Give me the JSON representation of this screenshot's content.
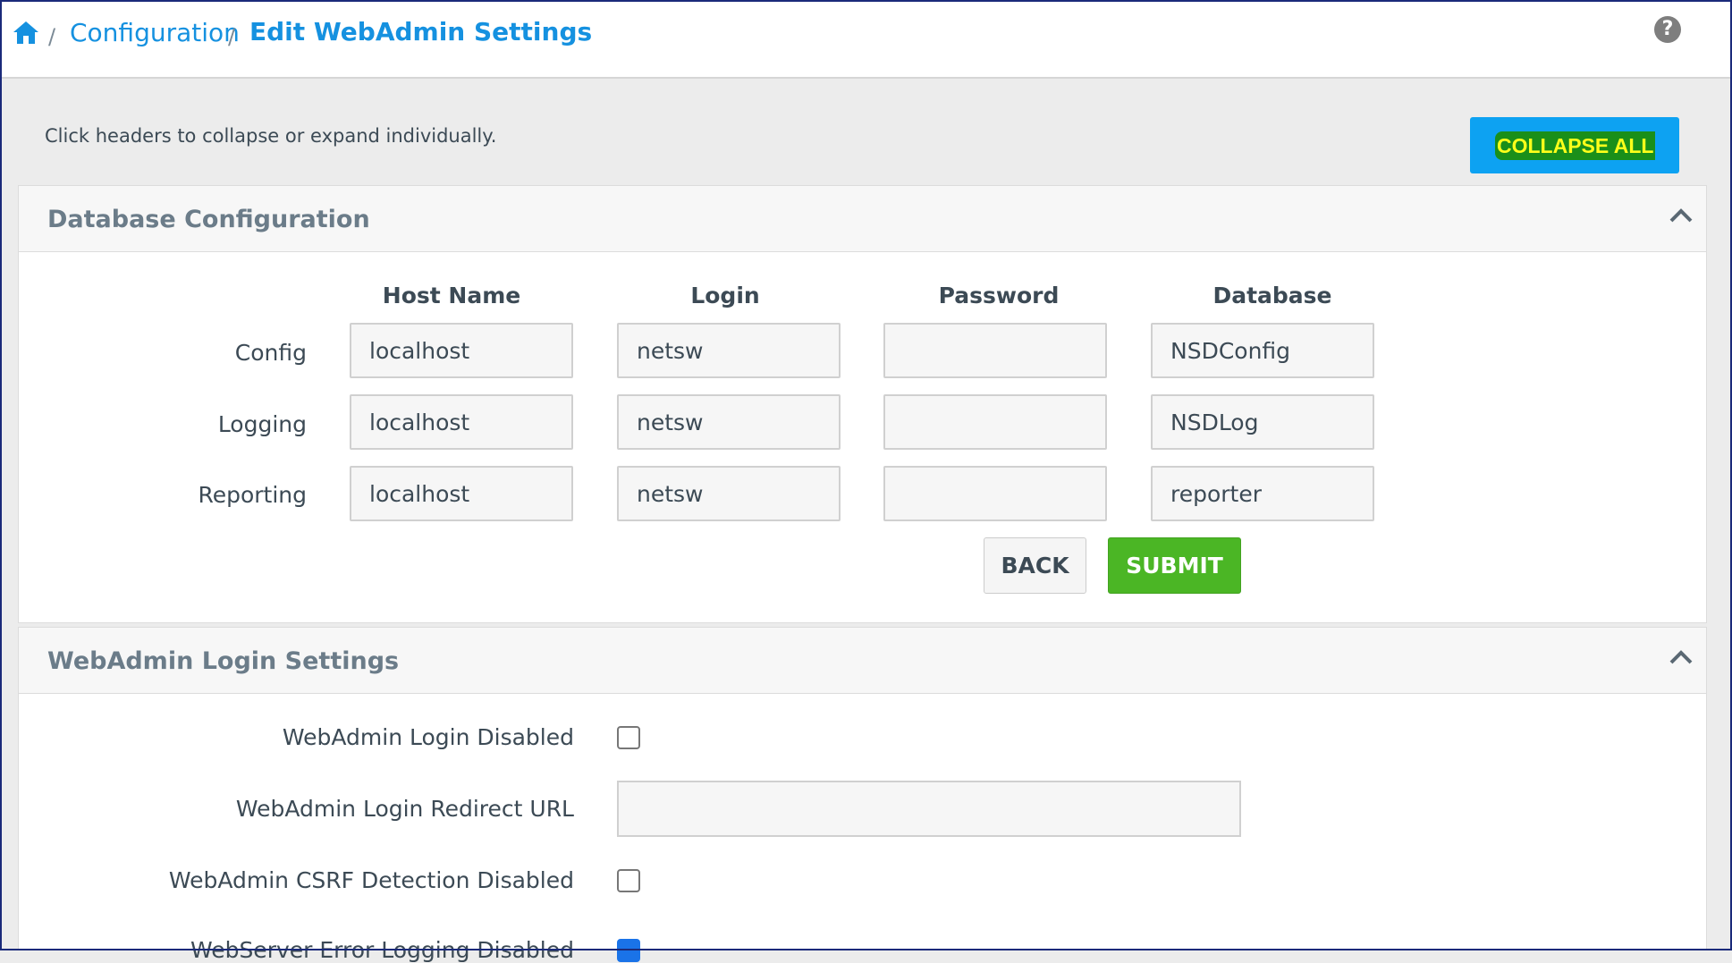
{
  "breadcrumb": {
    "home_icon": "home-icon",
    "separator": "/",
    "parent": "Configuration",
    "current": "Edit WebAdmin Settings"
  },
  "help_icon": "question-circle-icon",
  "hint": "Click headers to collapse or expand individually.",
  "collapse_all_label": "COLLAPSE ALL",
  "db_panel": {
    "title": "Database Configuration",
    "columns": [
      "Host Name",
      "Login",
      "Password",
      "Database"
    ],
    "rows": [
      {
        "label": "Config",
        "host": "localhost",
        "login": "netsw",
        "password": "",
        "database": "NSDConfig"
      },
      {
        "label": "Logging",
        "host": "localhost",
        "login": "netsw",
        "password": "",
        "database": "NSDLog"
      },
      {
        "label": "Reporting",
        "host": "localhost",
        "login": "netsw",
        "password": "",
        "database": "reporter"
      }
    ],
    "back_label": "BACK",
    "submit_label": "SUBMIT"
  },
  "login_panel": {
    "title": "WebAdmin Login Settings",
    "login_disabled_label": "WebAdmin Login Disabled",
    "login_disabled_checked": false,
    "redirect_url_label": "WebAdmin Login Redirect URL",
    "redirect_url_value": "",
    "csrf_label": "WebAdmin CSRF Detection Disabled",
    "csrf_checked": false,
    "partial_label": "WebServer Error Logging Disabled",
    "partial_checked": true
  },
  "colors": {
    "accent": "#1591e0",
    "collapse_button": "#0da2f2",
    "submit_button": "#4bb625",
    "highlight_bg": "#1a8f1a",
    "highlight_text": "#ffff1a"
  }
}
